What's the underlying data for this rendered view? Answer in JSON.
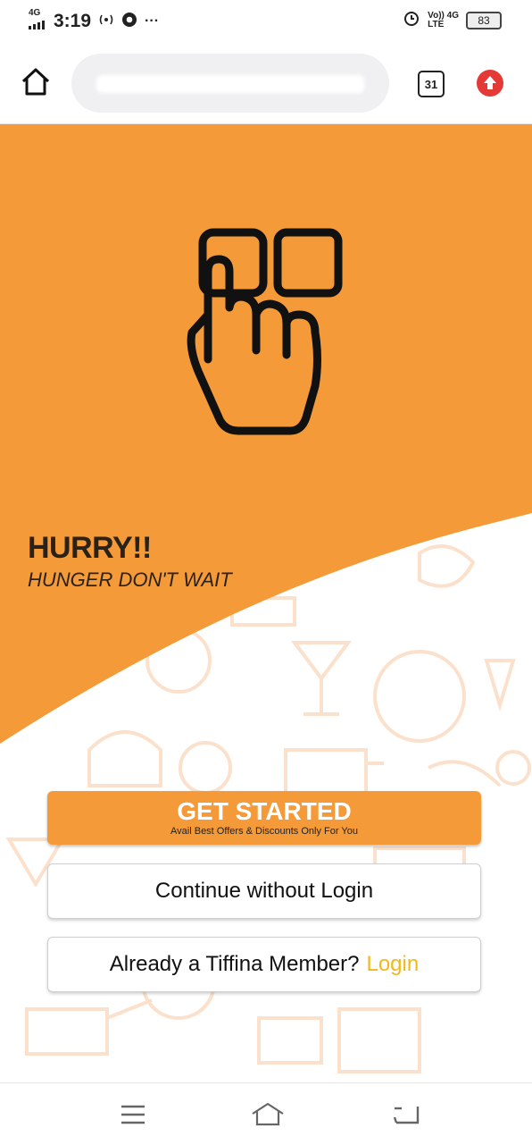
{
  "status_bar": {
    "network": "4G",
    "time": "3:19",
    "extra": "···",
    "volte": "Vo)) 4G",
    "lte": "LTE",
    "battery": "83"
  },
  "browser": {
    "tab_count": "31"
  },
  "hero": {
    "title": "HURRY!!",
    "tagline": "HUNGER DON'T WAIT"
  },
  "actions": {
    "get_started": "GET STARTED",
    "get_started_sub": "Avail Best Offers & Discounts Only For You",
    "continue_guest": "Continue without Login",
    "member_prompt": "Already a Tiffina Member?",
    "login_link": "Login"
  },
  "colors": {
    "brand_orange": "#f49a38",
    "login_yellow": "#f1b81a"
  },
  "icons": [
    "home-icon",
    "tabs-icon",
    "upgrade-icon",
    "tap-hand-icon",
    "menu-icon",
    "nav-home-icon",
    "back-icon"
  ]
}
